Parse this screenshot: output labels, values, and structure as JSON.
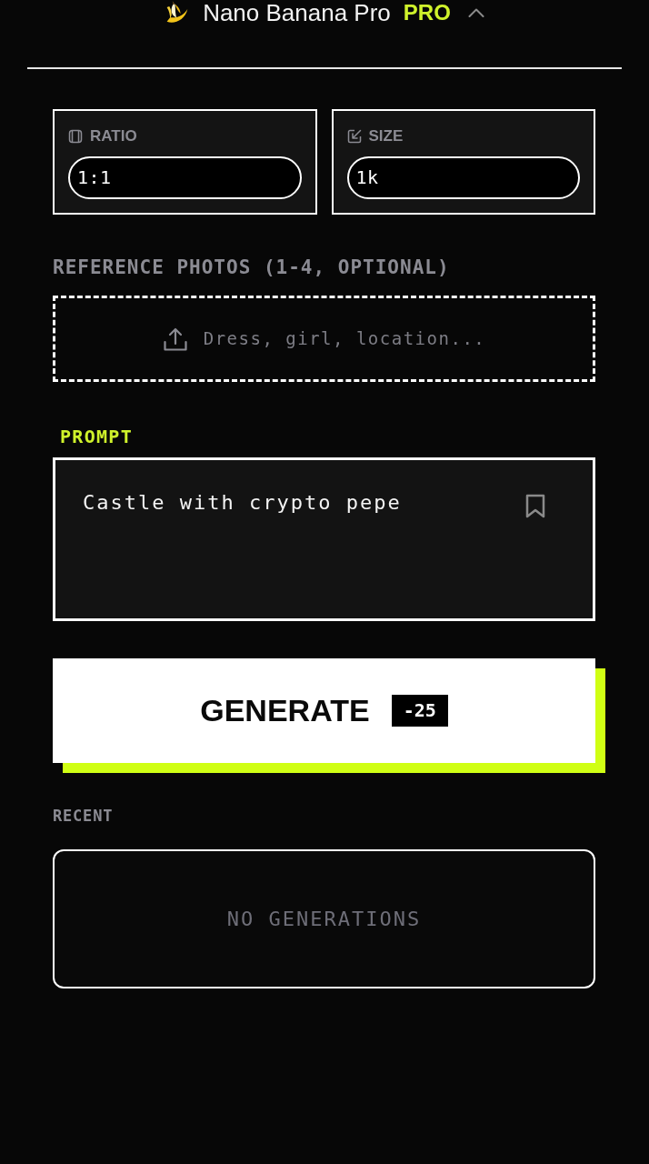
{
  "header": {
    "title": "Nano Banana Pro",
    "plan": "PRO"
  },
  "settings": [
    {
      "kind": "ratio",
      "label": "RATIO",
      "value": "1:1"
    },
    {
      "kind": "size",
      "label": "SIZE",
      "value": "1k"
    }
  ],
  "reference_photos": {
    "label": "REFERENCE PHOTOS (1-4, OPTIONAL)",
    "placeholder": "Dress, girl, location..."
  },
  "prompt": {
    "label": "PROMPT",
    "value": "Castle with crypto pepe"
  },
  "generate_button": {
    "label": "GENERATE",
    "cost": "-25"
  },
  "recent": {
    "label": "RECENT",
    "empty_text": "NO GENERATIONS"
  }
}
